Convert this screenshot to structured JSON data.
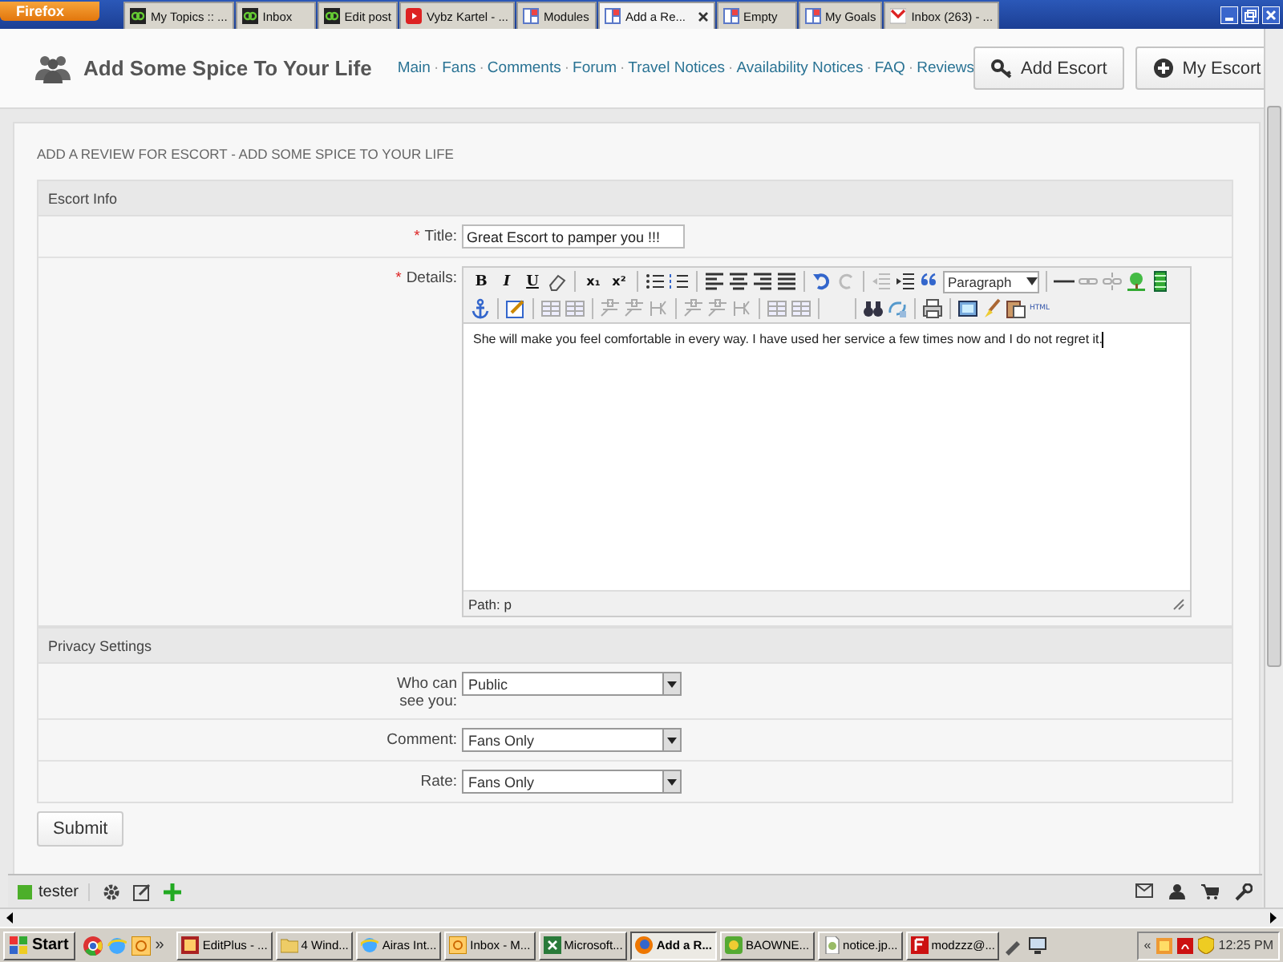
{
  "browser": {
    "menu_button": "Firefox",
    "tabs": [
      {
        "label": "My Topics :: ...",
        "kind": "forum",
        "selected": false
      },
      {
        "label": "Inbox",
        "kind": "forum",
        "selected": false
      },
      {
        "label": "Edit post",
        "kind": "forum",
        "selected": false
      },
      {
        "label": "Vybz Kartel - ...",
        "kind": "video",
        "selected": false
      },
      {
        "label": "Modules",
        "kind": "modules",
        "selected": false
      },
      {
        "label": "Add a Re...",
        "kind": "modules",
        "selected": true
      },
      {
        "label": "Empty",
        "kind": "modules",
        "selected": false
      },
      {
        "label": "My Goals",
        "kind": "modules",
        "selected": false
      },
      {
        "label": "Inbox (263) - ...",
        "kind": "mail",
        "selected": false
      }
    ]
  },
  "header": {
    "title": "Add Some Spice To Your Life",
    "nav_links": [
      "Main",
      "Fans",
      "Comments",
      "Forum",
      "Travel Notices",
      "Availability Notices",
      "FAQ",
      "Reviews"
    ],
    "nav_separator": "·",
    "buttons": [
      {
        "label": "Add Escort",
        "kind": "key"
      },
      {
        "label": "My Escort",
        "kind": "plus"
      }
    ]
  },
  "page_heading": "ADD A REVIEW FOR ESCORT - ADD SOME SPICE TO YOUR LIFE",
  "sections": [
    {
      "title": "Escort Info",
      "fields": [
        {
          "kind": "text",
          "label": "Title:",
          "required_mark": "*",
          "value": "Great Escort to pamper you !!!"
        },
        {
          "kind": "editor",
          "label": "Details:",
          "required_mark": "*",
          "toolbar_labels": [
            "B",
            "I",
            "U",
            "x₁",
            "x²",
            "HTML"
          ],
          "format_select": "Paragraph",
          "content": "She will make you feel comfortable in every way. I have used her service a few times now and I do not regret it.",
          "path": "Path: p"
        }
      ]
    },
    {
      "title": "Privacy Settings",
      "fields": [
        {
          "kind": "select",
          "label": "Who can see you:",
          "value": "Public"
        },
        {
          "kind": "select",
          "label": "Comment:",
          "value": "Fans Only"
        },
        {
          "kind": "select",
          "label": "Rate:",
          "value": "Fans Only"
        }
      ]
    }
  ],
  "submit_button": "Submit",
  "bottom_bar": {
    "user": "tester"
  },
  "taskbar": {
    "start": "Start",
    "more": "»",
    "items": [
      {
        "label": "EditPlus - ...",
        "kind": "editor",
        "selected": false
      },
      {
        "label": "4 Wind...",
        "kind": "folder",
        "selected": false
      },
      {
        "label": "Airas Int...",
        "kind": "ie",
        "selected": false
      },
      {
        "label": "Inbox - M...",
        "kind": "mail",
        "selected": false
      },
      {
        "label": "Microsoft...",
        "kind": "sheet",
        "selected": false
      },
      {
        "label": "Add a R...",
        "kind": "firefox",
        "selected": true
      },
      {
        "label": "BAOWNE...",
        "kind": "game",
        "selected": false
      },
      {
        "label": "notice.jp...",
        "kind": "image",
        "selected": false
      },
      {
        "label": "modzzz@...",
        "kind": "ftp",
        "selected": false
      }
    ],
    "tray_toggle": "«",
    "clock": "12:25 PM"
  }
}
